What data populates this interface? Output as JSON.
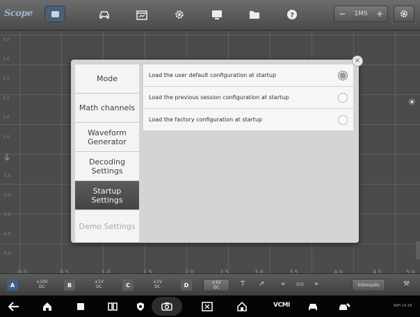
{
  "app": {
    "title": "Scope"
  },
  "toolbar": {
    "icons": [
      "channel-toggle-icon",
      "car-icon",
      "calendar-icon",
      "gear-icon",
      "monitor-icon",
      "folder-icon",
      "help-icon"
    ],
    "timebase": {
      "minus": "−",
      "value": "1MS",
      "plus": "+"
    }
  },
  "scope": {
    "y_labels": [
      "0.0",
      "3.0",
      "3.0",
      "3.0",
      "2.0",
      "1.0",
      "0.0",
      "-1.0",
      "-2.0",
      "-3.0",
      "-4.0",
      "-5.0"
    ],
    "x_labels": [
      "0.0",
      "0.5",
      "1.0",
      "1.5",
      "2.0",
      "2.5",
      "3.0",
      "3.5",
      "4.0",
      "4.5",
      "5.0"
    ]
  },
  "dialog": {
    "close_label": "×",
    "menu": [
      {
        "label": "Mode",
        "state": "normal"
      },
      {
        "label": "Math channels",
        "state": "normal"
      },
      {
        "label": "Waveform Generator",
        "state": "normal"
      },
      {
        "label": "Decoding Settings",
        "state": "normal"
      },
      {
        "label": "Startup Settings",
        "state": "active"
      },
      {
        "label": "Demo Settings",
        "state": "disabled"
      }
    ],
    "options": [
      {
        "label": "Load the user default configuration at startup",
        "checked": true
      },
      {
        "label": "Load the previous session configuration at startup",
        "checked": false
      },
      {
        "label": "Load the factory configuration at startup",
        "checked": false
      }
    ]
  },
  "channel_bar": {
    "channels": [
      {
        "badge": "A",
        "scale": "±10V",
        "coupling": "DC",
        "color": "#3f5f86"
      },
      {
        "badge": "B",
        "scale": "±1V",
        "coupling": "DC",
        "color": "#5f5f5f"
      },
      {
        "badge": "C",
        "scale": "±1V",
        "coupling": "DC",
        "color": "#5f5f5f"
      },
      {
        "badge": "D",
        "scale": "±1V",
        "coupling": "DC",
        "color": "#5f5f5f"
      }
    ],
    "trigger_label": "T",
    "edge_label": "↗",
    "prev_label": "«",
    "page_label": "0/0",
    "next_label": "»",
    "sample_rate": "500ms/div",
    "tool_icon": "wrench-icon"
  },
  "navbar": {
    "icons": [
      "back-icon",
      "home-icon",
      "recents-icon",
      "split-screen-icon",
      "shield-icon",
      "camera-icon",
      "screenshot-icon",
      "autel-home-icon",
      "vci-icon",
      "car-icon",
      "car-repair-icon"
    ],
    "vci_label": "VCMI",
    "status": "WiFi 14:18"
  }
}
